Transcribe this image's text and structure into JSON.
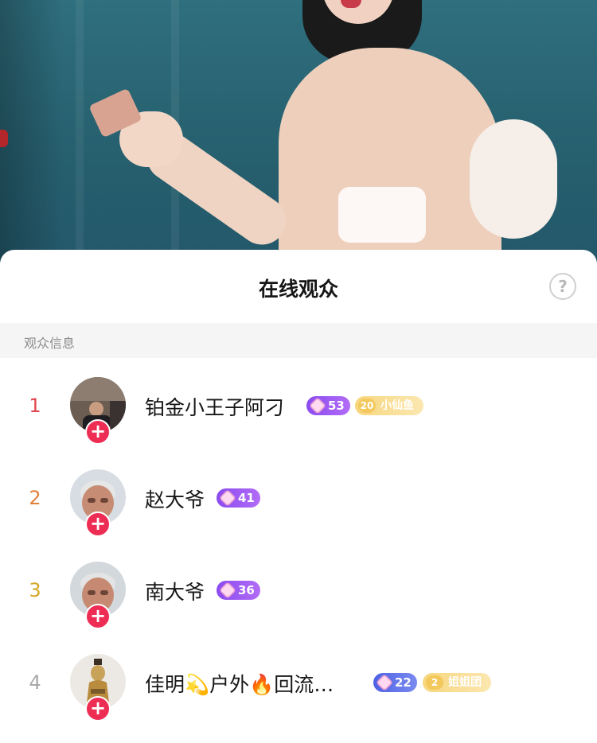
{
  "sheet": {
    "title": "在线观众",
    "help_icon_glyph": "?",
    "section_label": "观众信息"
  },
  "colors": {
    "rank_1": "#e0444e",
    "rank_2": "#e0813a",
    "rank_3": "#d4a826",
    "rank_4": "#a8a8a8",
    "follow_button": "#ee2d55"
  },
  "audience": [
    {
      "rank": "1",
      "name": "铂金小王子阿刁",
      "level": "53",
      "fan_level": "20",
      "fan_club": "小仙鱼"
    },
    {
      "rank": "2",
      "name": "赵大爷",
      "level": "41"
    },
    {
      "rank": "3",
      "name": "南大爷",
      "level": "36"
    },
    {
      "rank": "4",
      "name": "佳明💫户外🔥回流…",
      "level": "22",
      "fan_level": "2",
      "fan_club": "姐姐团"
    }
  ],
  "follow_glyph": "+"
}
